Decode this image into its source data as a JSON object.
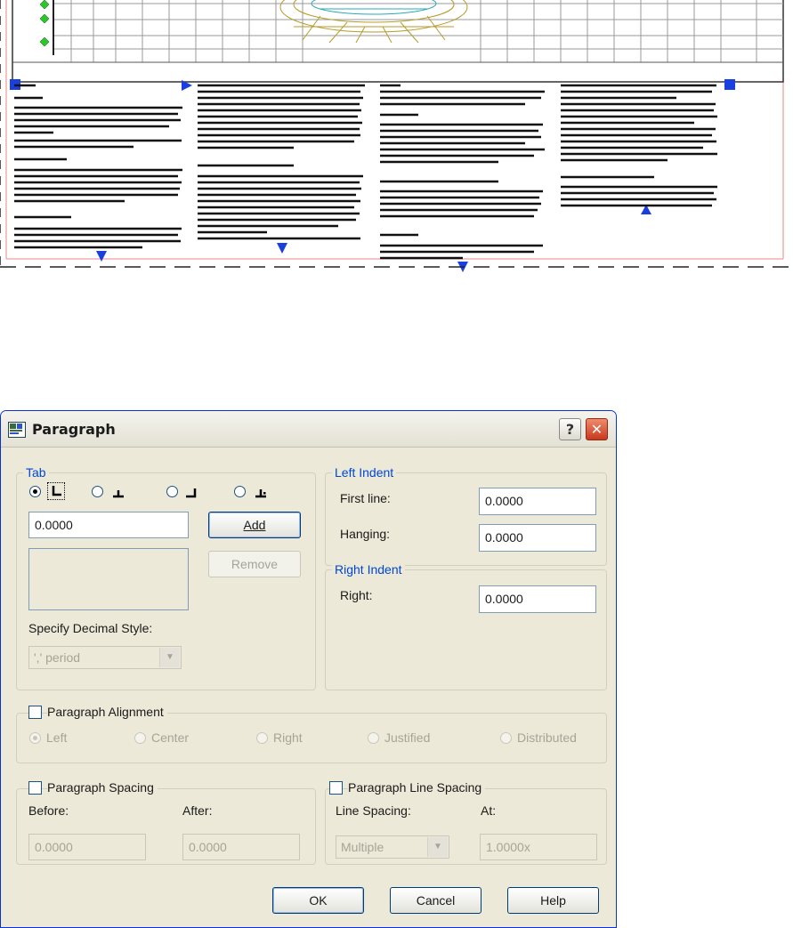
{
  "dialog": {
    "title": "Paragraph",
    "tab_group": {
      "label": "Tab",
      "tab_value": "0.0000",
      "add_label": "Add",
      "remove_label": "Remove",
      "decimal_style_label": "Specify Decimal Style:",
      "decimal_style_value": "',' period",
      "tab_types": [
        "left-tab",
        "center-tab",
        "right-tab",
        "decimal-tab"
      ],
      "selected_tab_type": "left-tab"
    },
    "left_indent": {
      "label": "Left Indent",
      "first_line_label": "First line:",
      "first_line_value": "0.0000",
      "hanging_label": "Hanging:",
      "hanging_value": "0.0000"
    },
    "right_indent": {
      "label": "Right Indent",
      "right_label": "Right:",
      "right_value": "0.0000"
    },
    "paragraph_alignment": {
      "label": "Paragraph Alignment",
      "checked": false,
      "options": [
        "Left",
        "Center",
        "Right",
        "Justified",
        "Distributed"
      ],
      "selected": "Left"
    },
    "paragraph_spacing": {
      "label": "Paragraph Spacing",
      "checked": false,
      "before_label": "Before:",
      "before_value": "0.0000",
      "after_label": "After:",
      "after_value": "0.0000"
    },
    "line_spacing": {
      "label": "Paragraph Line Spacing",
      "checked": false,
      "line_spacing_label": "Line Spacing:",
      "line_spacing_value": "Multiple",
      "at_label": "At:",
      "at_value": "1.0000x"
    },
    "buttons": {
      "ok": "OK",
      "cancel": "Cancel",
      "help": "Help"
    }
  },
  "colors": {
    "dialog_bg": "#ece9d8",
    "group_label": "#0046d5",
    "grip_blue": "#1a3fe0",
    "cad_frame": "#e88a8a"
  }
}
